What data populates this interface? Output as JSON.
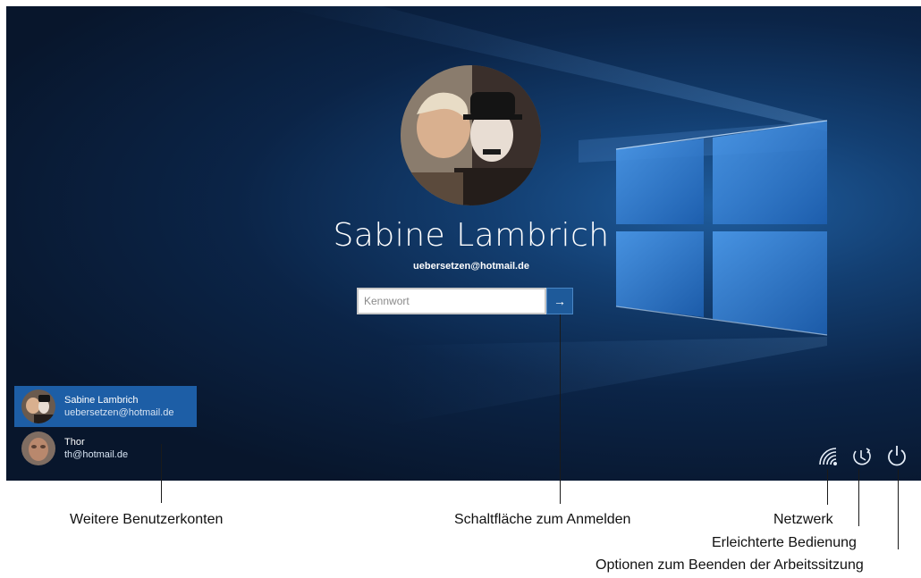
{
  "login": {
    "user_name": "Sabine Lambrich",
    "user_email": "uebersetzen@hotmail.de",
    "password_placeholder": "Kennwort",
    "submit_glyph": "→"
  },
  "accounts": [
    {
      "name": "Sabine Lambrich",
      "email": "uebersetzen@hotmail.de",
      "selected": true
    },
    {
      "name": "Thor",
      "email": "th@hotmail.de",
      "selected": false
    }
  ],
  "system_icons": [
    "network-icon",
    "ease-of-access-icon",
    "power-icon"
  ],
  "callouts": {
    "accounts": "Weitere Benutzerkonten",
    "signin": "Schaltfläche zum Anmelden",
    "network": "Netzwerk",
    "ease": "Erleichterte Bedienung",
    "power": "Optionen zum Beenden der Arbeitssitzung"
  },
  "colors": {
    "background": "#0b2447",
    "accent": "#1d5ea6",
    "logo": "#3f8fe0"
  }
}
